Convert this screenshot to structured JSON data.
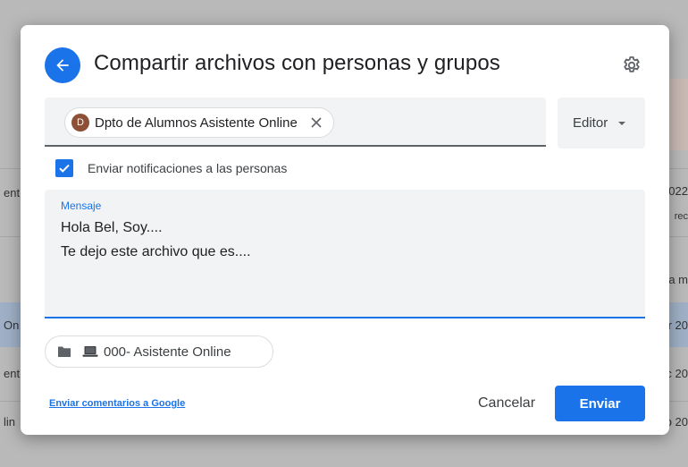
{
  "background": {
    "left_fragments": [
      "ent",
      "On",
      "ent",
      "lin"
    ],
    "right_fragments": [
      "022",
      "rec",
      "a m",
      "r 20",
      "c 20",
      "o 20"
    ]
  },
  "dialog": {
    "title": "Compartir archivos con personas y grupos",
    "back_icon": "arrow-left-icon",
    "settings_icon": "gear-icon",
    "recipient": {
      "avatar_letter": "D",
      "name": "Dpto de Alumnos Asistente Online",
      "remove_icon": "close-icon"
    },
    "role": {
      "selected": "Editor",
      "icon": "caret-down-icon"
    },
    "notify": {
      "checked": true,
      "label": "Enviar notificaciones a las personas"
    },
    "message": {
      "label": "Mensaje",
      "value": "Hola Bel, Soy....\nTe dejo este archivo que es...."
    },
    "folder": {
      "folder_icon": "folder-icon",
      "item_icon": "laptop-icon",
      "label": "000- Asistente Online"
    },
    "feedback_link": "Enviar comentarios a Google",
    "cancel_label": "Cancelar",
    "send_label": "Enviar"
  },
  "colors": {
    "accent": "#1a73e8",
    "avatar": "#8d4f35",
    "field_bg": "#f1f3f4"
  }
}
